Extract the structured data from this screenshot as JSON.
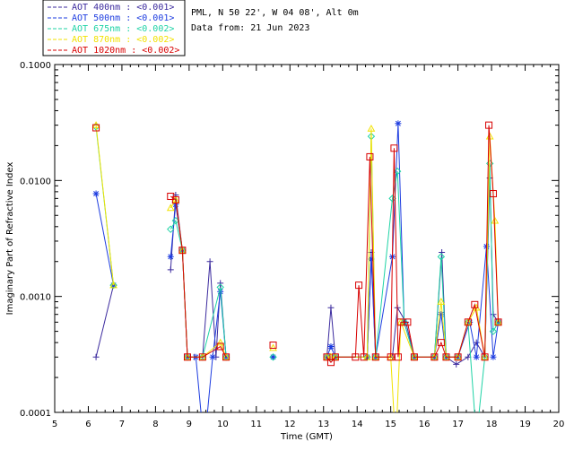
{
  "header": {
    "site": "PML, N 50 22', W 04 08', Alt 0m",
    "date": "Data from: 21 Jun 2023"
  },
  "legend": [
    {
      "label": "AOT  400nm : <0.001>",
      "color": "#3b2a9e"
    },
    {
      "label": "AOT  500nm : <0.001>",
      "color": "#1e3de0"
    },
    {
      "label": "AOT  675nm : <0.002>",
      "color": "#1fd3a6"
    },
    {
      "label": "AOT  870nm : <0.002>",
      "color": "#f2e200"
    },
    {
      "label": "AOT 1020nm : <0.002>",
      "color": "#d80000"
    }
  ],
  "chart_data": {
    "type": "line",
    "xlabel": "Time (GMT)",
    "ylabel": "Imaginary Part of Refractive Index",
    "xlim": [
      5,
      20
    ],
    "ylim": [
      0.0001,
      0.1
    ],
    "y_scale": "log",
    "x_ticks": [
      "5",
      "6",
      "7",
      "8",
      "9",
      "10",
      "11",
      "12",
      "13",
      "14",
      "15",
      "16",
      "17",
      "18",
      "19",
      "20"
    ],
    "y_ticks": [
      "0.0001",
      "0.0010",
      "0.0100",
      "0.1000"
    ],
    "series": [
      {
        "name": "AOT  400nm : <0.001>",
        "color": "#3b2a9e",
        "marker": "plus",
        "points": [
          [
            6.23,
            0.0003
          ],
          [
            6.75,
            0.00125
          ],
          [
            8.45,
            0.0017
          ],
          [
            8.6,
            0.0075
          ],
          [
            8.8,
            0.0025
          ],
          [
            8.95,
            0.0003
          ],
          [
            9.15,
            0.0003
          ],
          [
            9.4,
            0.0003
          ],
          [
            9.62,
            0.002
          ],
          [
            9.8,
            0.0003
          ],
          [
            9.93,
            0.0013
          ],
          [
            10.1,
            0.0003
          ],
          [
            11.5,
            0.0003
          ],
          [
            13.1,
            0.0003
          ],
          [
            13.22,
            0.0008
          ],
          [
            13.35,
            0.0003
          ],
          [
            14.3,
            0.0003
          ],
          [
            14.42,
            0.0024
          ],
          [
            14.55,
            0.0003
          ],
          [
            15.05,
            0.0003
          ],
          [
            15.2,
            0.0008
          ],
          [
            15.45,
            0.0006
          ],
          [
            15.7,
            0.0003
          ],
          [
            16.3,
            0.0003
          ],
          [
            16.52,
            0.0024
          ],
          [
            16.65,
            0.0003
          ],
          [
            16.95,
            0.00026
          ],
          [
            17.3,
            0.0003
          ],
          [
            17.55,
            0.0004
          ],
          [
            17.8,
            0.0003
          ],
          [
            17.95,
            0.0105
          ],
          [
            18.05,
            0.0007
          ],
          [
            18.2,
            0.0006
          ]
        ]
      },
      {
        "name": "AOT  500nm : <0.001>",
        "color": "#1e3de0",
        "marker": "star",
        "points": [
          [
            6.23,
            0.0077
          ],
          [
            6.75,
            0.00125
          ],
          [
            8.45,
            0.0022
          ],
          [
            8.6,
            0.0062
          ],
          [
            8.8,
            0.0025
          ],
          [
            8.95,
            0.0003
          ],
          [
            9.2,
            0.0003
          ],
          [
            9.45,
            5e-05
          ],
          [
            9.7,
            0.0003
          ],
          [
            9.93,
            0.0011
          ],
          [
            10.1,
            0.0003
          ],
          [
            11.5,
            0.0003
          ],
          [
            13.1,
            0.0003
          ],
          [
            13.22,
            0.00037
          ],
          [
            13.35,
            0.0003
          ],
          [
            14.3,
            0.0003
          ],
          [
            14.42,
            0.0021
          ],
          [
            14.55,
            0.0003
          ],
          [
            15.05,
            0.0022
          ],
          [
            15.22,
            0.031
          ],
          [
            15.4,
            0.0006
          ],
          [
            15.7,
            0.0003
          ],
          [
            16.3,
            0.0003
          ],
          [
            16.5,
            0.0007
          ],
          [
            16.65,
            0.0003
          ],
          [
            17.0,
            0.0003
          ],
          [
            17.35,
            0.0006
          ],
          [
            17.55,
            0.0003
          ],
          [
            17.85,
            0.0027
          ],
          [
            18.05,
            0.0003
          ],
          [
            18.2,
            0.0006
          ]
        ]
      },
      {
        "name": "AOT  675nm : <0.002>",
        "color": "#1fd3a6",
        "marker": "diamond",
        "points": [
          [
            6.23,
            0.029
          ],
          [
            6.75,
            0.00125
          ],
          [
            8.45,
            0.0038
          ],
          [
            8.6,
            0.0045
          ],
          [
            8.8,
            0.0025
          ],
          [
            8.95,
            0.0003
          ],
          [
            9.4,
            0.0003
          ],
          [
            9.93,
            0.0012
          ],
          [
            10.1,
            0.0003
          ],
          [
            11.5,
            0.0003
          ],
          [
            13.1,
            0.0003
          ],
          [
            13.22,
            0.0003
          ],
          [
            13.35,
            0.0003
          ],
          [
            14.3,
            0.0003
          ],
          [
            14.42,
            0.024
          ],
          [
            14.55,
            0.0003
          ],
          [
            15.05,
            0.007
          ],
          [
            15.2,
            0.012
          ],
          [
            15.4,
            0.0006
          ],
          [
            15.7,
            0.0003
          ],
          [
            16.3,
            0.0003
          ],
          [
            16.5,
            0.0022
          ],
          [
            16.65,
            0.0003
          ],
          [
            17.0,
            0.0003
          ],
          [
            17.3,
            0.0006
          ],
          [
            17.55,
            6e-05
          ],
          [
            17.8,
            0.0003
          ],
          [
            17.95,
            0.014
          ],
          [
            18.05,
            0.0005
          ],
          [
            18.2,
            0.0006
          ]
        ]
      },
      {
        "name": "AOT  870nm : <0.002>",
        "color": "#f2e200",
        "marker": "triangle",
        "points": [
          [
            6.23,
            0.03
          ],
          [
            6.75,
            0.00125
          ],
          [
            8.45,
            0.0058
          ],
          [
            8.6,
            0.0068
          ],
          [
            8.8,
            0.0025
          ],
          [
            8.95,
            0.0003
          ],
          [
            9.4,
            0.0003
          ],
          [
            9.93,
            0.0004
          ],
          [
            10.1,
            0.0003
          ],
          [
            11.5,
            0.00036
          ],
          [
            13.1,
            0.0003
          ],
          [
            13.22,
            0.0003
          ],
          [
            13.35,
            0.0003
          ],
          [
            14.3,
            0.0003
          ],
          [
            14.42,
            0.028
          ],
          [
            14.55,
            0.0003
          ],
          [
            15.0,
            0.0003
          ],
          [
            15.15,
            5e-05
          ],
          [
            15.3,
            0.0006
          ],
          [
            15.7,
            0.0003
          ],
          [
            16.3,
            0.0003
          ],
          [
            16.5,
            0.0009
          ],
          [
            16.65,
            0.0003
          ],
          [
            17.0,
            0.0003
          ],
          [
            17.3,
            0.0006
          ],
          [
            17.55,
            0.0008
          ],
          [
            17.8,
            0.0003
          ],
          [
            17.95,
            0.024
          ],
          [
            18.1,
            0.0045
          ],
          [
            18.2,
            0.0006
          ]
        ]
      },
      {
        "name": "AOT 1020nm : <0.002>",
        "color": "#d80000",
        "marker": "square",
        "points": [
          [
            6.23,
            0.0285
          ],
          [
            8.45,
            0.0073
          ],
          [
            8.6,
            0.0068
          ],
          [
            8.8,
            0.0025
          ],
          [
            8.95,
            0.0003
          ],
          [
            9.4,
            0.0003
          ],
          [
            9.93,
            0.00037
          ],
          [
            10.1,
            0.0003
          ],
          [
            11.5,
            0.00038
          ],
          [
            13.1,
            0.0003
          ],
          [
            13.22,
            0.00027
          ],
          [
            13.35,
            0.0003
          ],
          [
            13.95,
            0.0003
          ],
          [
            14.05,
            0.00125
          ],
          [
            14.2,
            0.0003
          ],
          [
            14.38,
            0.016
          ],
          [
            14.55,
            0.0003
          ],
          [
            15.0,
            0.0003
          ],
          [
            15.1,
            0.019
          ],
          [
            15.22,
            0.0003
          ],
          [
            15.3,
            0.0006
          ],
          [
            15.5,
            0.0006
          ],
          [
            15.7,
            0.0003
          ],
          [
            16.3,
            0.0003
          ],
          [
            16.5,
            0.0004
          ],
          [
            16.65,
            0.0003
          ],
          [
            17.0,
            0.0003
          ],
          [
            17.3,
            0.0006
          ],
          [
            17.5,
            0.00085
          ],
          [
            17.8,
            0.0003
          ],
          [
            17.92,
            0.03
          ],
          [
            18.05,
            0.0077
          ],
          [
            18.2,
            0.0006
          ]
        ]
      }
    ]
  }
}
